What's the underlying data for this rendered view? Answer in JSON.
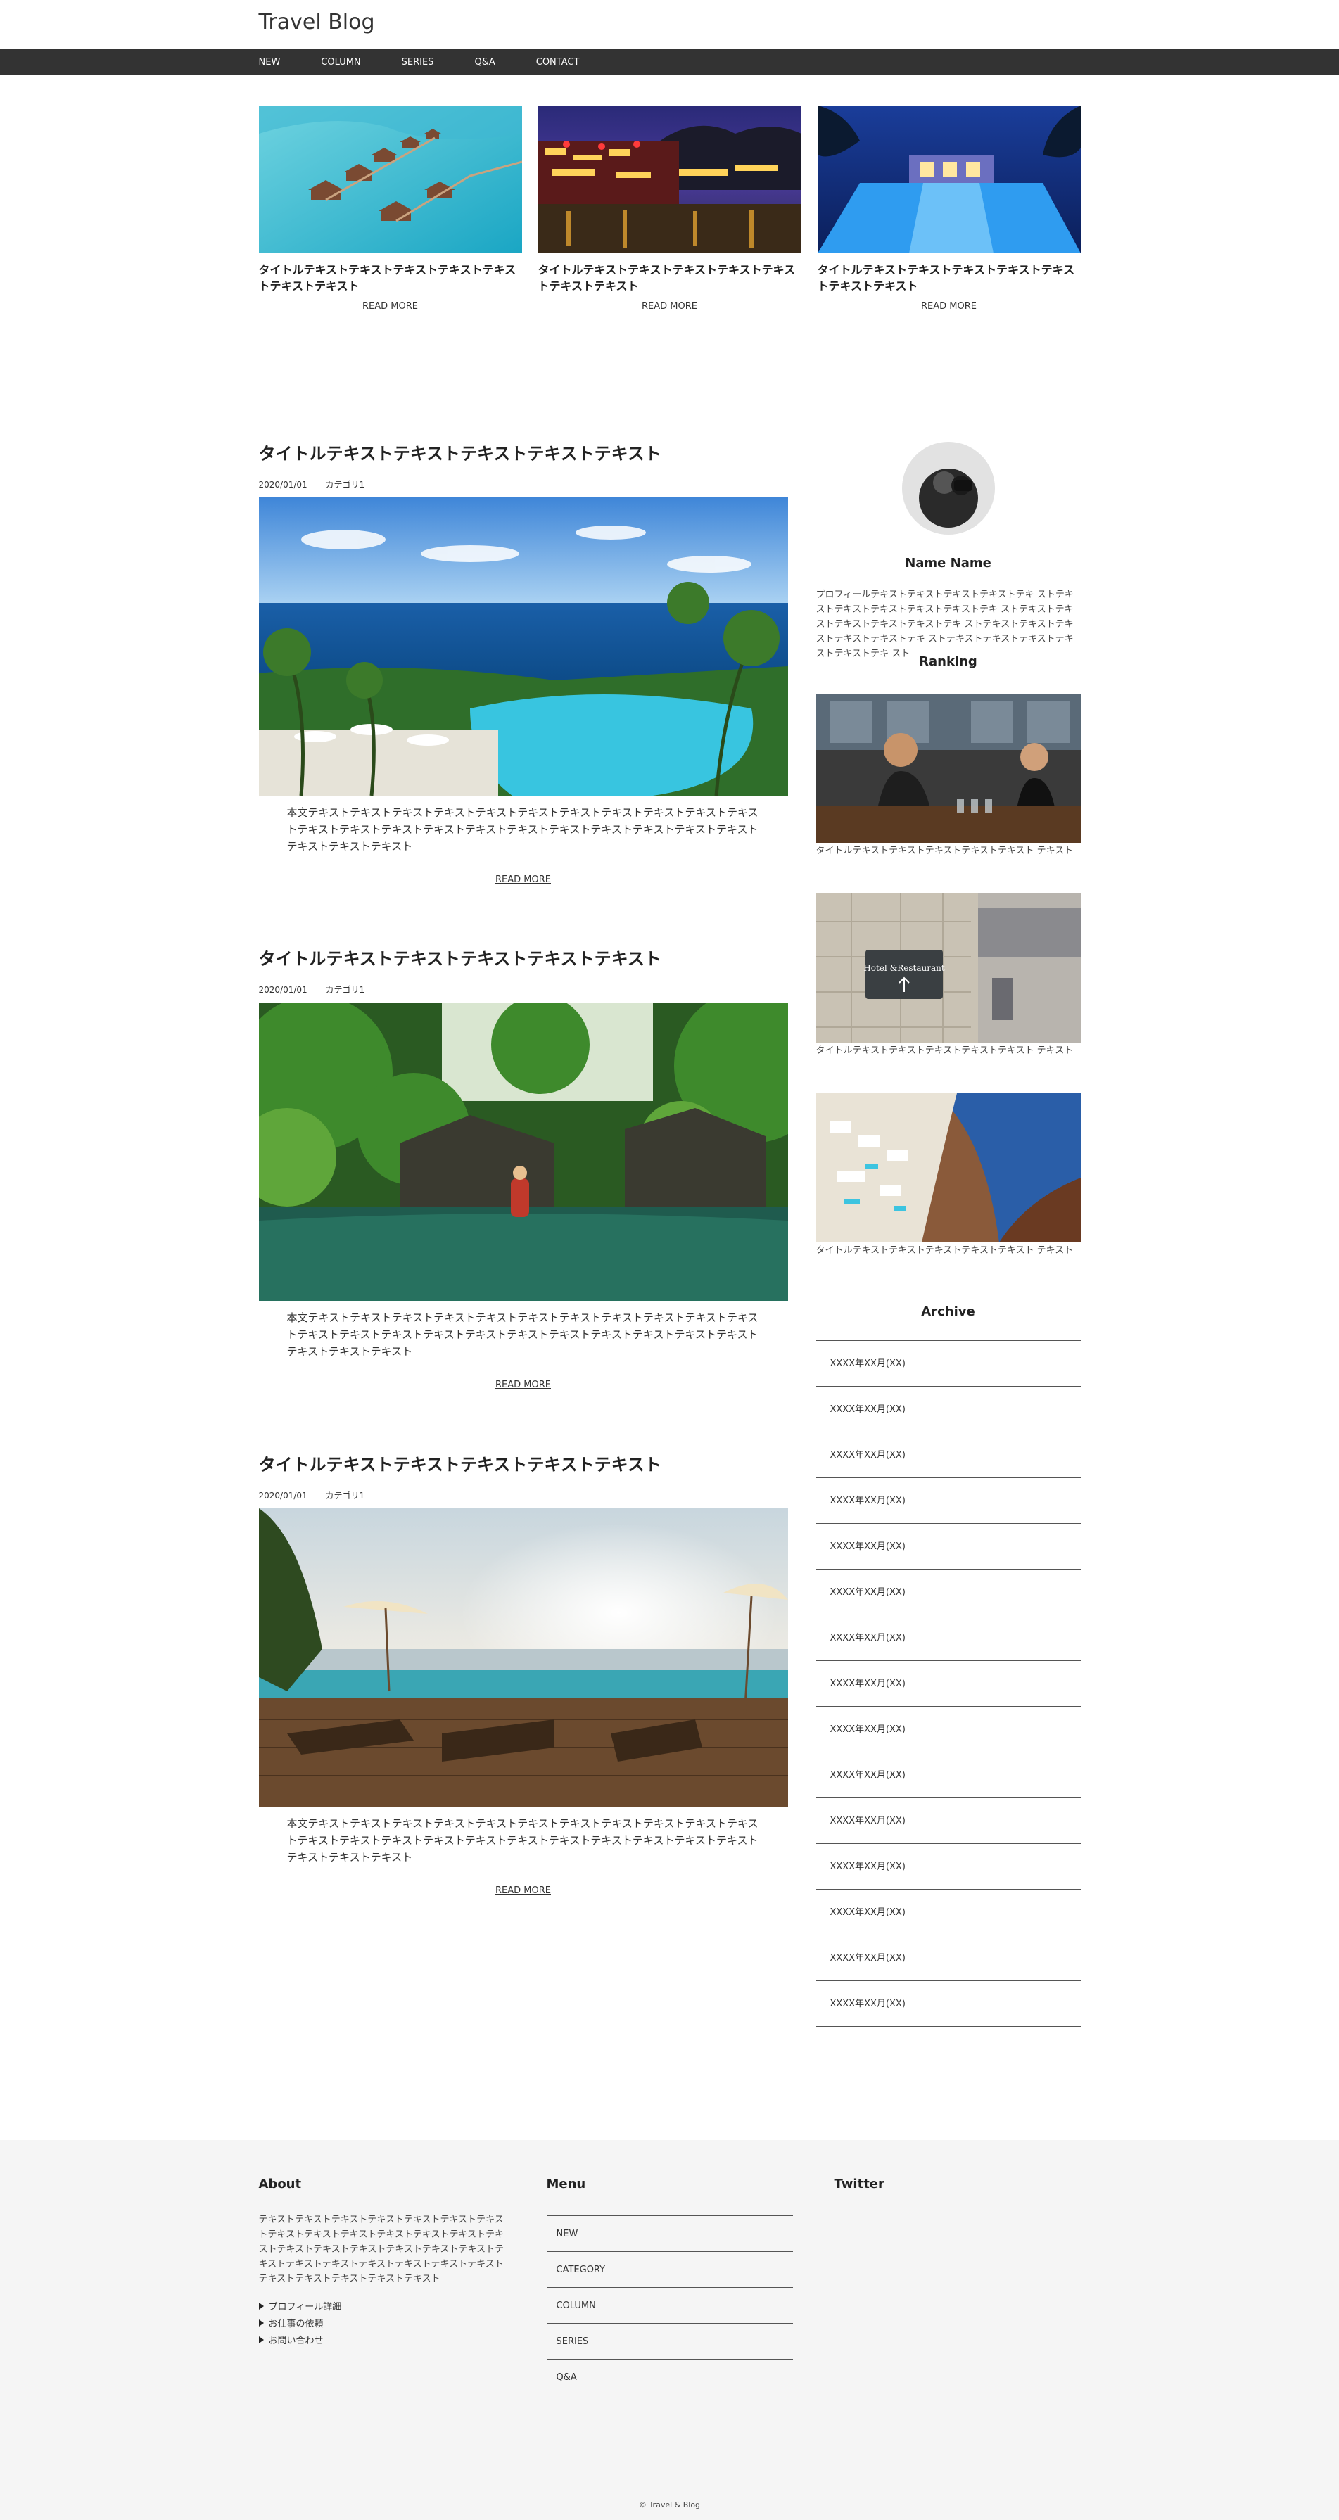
{
  "site": {
    "title": "Travel Blog"
  },
  "nav": {
    "items": [
      "NEW",
      "COLUMN",
      "SERIES",
      "Q&A",
      "CONTACT"
    ]
  },
  "pickup": [
    {
      "title": "タイトルテキストテキストテキストテキストテキストテキストテキスト",
      "readmore": "READ MORE",
      "image": "overwater-bungalows"
    },
    {
      "title": "タイトルテキストテキストテキストテキストテキストテキストテキスト",
      "readmore": "READ MORE",
      "image": "night-lake-town"
    },
    {
      "title": "タイトルテキストテキストテキストテキストテキストテキストテキスト",
      "readmore": "READ MORE",
      "image": "night-pool-resort"
    }
  ],
  "articles": [
    {
      "title": "タイトルテキストテキストテキストテキストテキスト",
      "date": "2020/01/01",
      "category": "カテゴリ1",
      "body": "本文テキストテキストテキストテキストテキストテキストテキストテキストテキストテキストテキストテキストテキストテキストテキストテキストテキストテキストテキストテキストテキストテキストテキストテキストテキスト",
      "readmore": "READ MORE",
      "image": "ocean-infinity-pool"
    },
    {
      "title": "タイトルテキストテキストテキストテキストテキスト",
      "date": "2020/01/01",
      "category": "カテゴリ1",
      "body": "本文テキストテキストテキストテキストテキストテキストテキストテキストテキストテキストテキストテキストテキストテキストテキストテキストテキストテキストテキストテキストテキストテキストテキストテキストテキスト",
      "readmore": "READ MORE",
      "image": "jungle-pool-woman"
    },
    {
      "title": "タイトルテキストテキストテキストテキストテキスト",
      "date": "2020/01/01",
      "category": "カテゴリ1",
      "body": "本文テキストテキストテキストテキストテキストテキストテキストテキストテキストテキストテキストテキストテキストテキストテキストテキストテキストテキストテキストテキストテキストテキストテキストテキストテキスト",
      "readmore": "READ MORE",
      "image": "sunset-deck-loungers"
    }
  ],
  "profile": {
    "name": "Name Name",
    "text": "プロフィールテキストテキストテキストテキストテキ ストテキストテキストテキストテキストテキストテキ ストテキストテキストテキストテキストテキストテキ ストテキストテキストテキストテキストテキストテキ ストテキストテキストテキストテキストテキストテキ スト"
  },
  "ranking": {
    "heading": "Ranking",
    "items": [
      {
        "caption": "タイトルテキストテキストテキストテキストテキスト テキスト",
        "image": "bar-bartenders"
      },
      {
        "caption": "タイトルテキストテキストテキストテキストテキスト テキスト",
        "image": "stone-wall-signboard"
      },
      {
        "caption": "タイトルテキストテキストテキストテキストテキスト テキスト",
        "image": "cliffside-village-sea"
      }
    ]
  },
  "archive": {
    "heading": "Archive",
    "items": [
      "XXXX年XX月(XX)",
      "XXXX年XX月(XX)",
      "XXXX年XX月(XX)",
      "XXXX年XX月(XX)",
      "XXXX年XX月(XX)",
      "XXXX年XX月(XX)",
      "XXXX年XX月(XX)",
      "XXXX年XX月(XX)",
      "XXXX年XX月(XX)",
      "XXXX年XX月(XX)",
      "XXXX年XX月(XX)",
      "XXXX年XX月(XX)",
      "XXXX年XX月(XX)",
      "XXXX年XX月(XX)",
      "XXXX年XX月(XX)"
    ]
  },
  "footer": {
    "about": {
      "heading": "About",
      "text": "テキストテキストテキストテキストテキストテキストテキストテキストテキストテキストテキストテキストテキストテキストテキストテキストテキストテキストテキストテキストテキストテキストテキストテキストテキストテキストテキストテキストテキストテキストテキストテキスト",
      "links": [
        "プロフィール詳細",
        "お仕事の依頼",
        "お問い合わせ"
      ]
    },
    "menu": {
      "heading": "Menu",
      "items": [
        "NEW",
        "CATEGORY",
        "COLUMN",
        "SERIES",
        "Q&A"
      ]
    },
    "twitter": {
      "heading": "Twitter"
    },
    "copyright": "© Travel & Blog"
  }
}
